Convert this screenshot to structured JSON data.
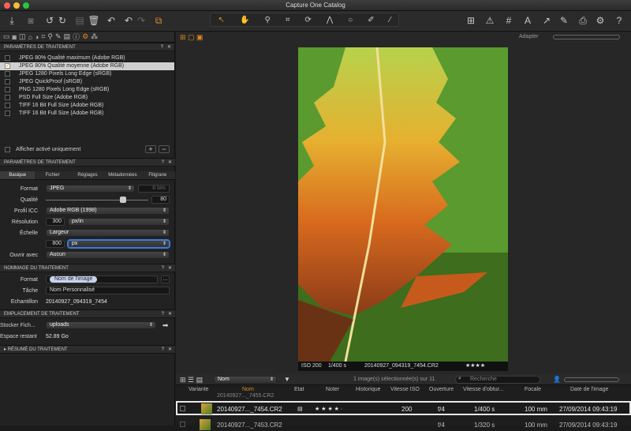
{
  "window": {
    "title": "Capture One Catalog"
  },
  "toolbar": {
    "adapter": "Adapter"
  },
  "recipes": {
    "header": "PARAMÈTRES DE TRAITEMENT",
    "items": [
      {
        "label": "JPEG 80% Qualité maximum (Adobe RGB)",
        "checked": false
      },
      {
        "label": "JPEG 80% Qualité moyenne (Adobe RGB)",
        "checked": true
      },
      {
        "label": "JPEG 1280 Pixels Long Edge (sRGB)",
        "checked": false
      },
      {
        "label": "JPEG QuickProof (sRGB)",
        "checked": false
      },
      {
        "label": "PNG 1280 Pixels Long Edge (sRGB)",
        "checked": false
      },
      {
        "label": "PSD Full Size (Adobe RGB)",
        "checked": false
      },
      {
        "label": "TIFF 16 Bit Full Size (Adobe RGB)",
        "checked": false
      },
      {
        "label": "TIFF 16 Bit Full Size (Adobe RGB)",
        "checked": false
      }
    ],
    "show_active": "Afficher activé uniquement"
  },
  "settings": {
    "header": "PARAMÈTRES DE TRAITEMENT",
    "tabs": [
      "Basique",
      "Fichier",
      "Réglages",
      "Métadonnées",
      "Filigrane"
    ],
    "format_label": "Format",
    "format_value": "JPEG",
    "bits": "8 bits",
    "quality_label": "Qualité",
    "quality_value": "80",
    "icc_label": "Profil ICC",
    "icc_value": "Adobe RGB (1998)",
    "res_label": "Résolution",
    "res_value": "300",
    "res_unit": "px/in",
    "scale_label": "Échelle",
    "scale_value": "Largeur",
    "size_value": "800",
    "size_unit": "px",
    "open_label": "Ouvrir avec",
    "open_value": "Aucun"
  },
  "naming": {
    "header": "NOMMAGE DU TRAITEMENT",
    "format_label": "Format",
    "format_token": "Nom de l'image",
    "task_label": "Tâche",
    "task_value": "Nom Personnalisé",
    "sample_label": "Echantillon",
    "sample_value": "20140927_094319_7454"
  },
  "location": {
    "header": "EMPLACEMENT DE TRAITEMENT",
    "store_label": "Stocker Fich...",
    "store_value": "uploads",
    "space_label": "Espace restant",
    "space_value": "52.89 Go"
  },
  "summary": {
    "header": "RÉSUMÉ DU TRAITEMENT"
  },
  "viewer": {
    "iso": "ISO 200",
    "shutter": "1/400 s",
    "filename": "20140927_094319_7454.CR2",
    "stars": "★★★★"
  },
  "browser": {
    "sort": "Nom",
    "count": "1 image(s) sélectionnée(s) sur 11",
    "search_placeholder": "Recherche",
    "columns": [
      "Variante",
      "Nom",
      "Etat",
      "Noter",
      "Historique",
      "Vitesse ISO",
      "Ouverture",
      "Vitesse d'obtur...",
      "Focale",
      "Date de l'image"
    ],
    "rows": [
      {
        "name": "20140927..._7454.CR2",
        "stars": "★ ★ ★ ★ ·",
        "iso": "200",
        "aperture": "f/4",
        "shutter": "1/400 s",
        "focal": "100 mm",
        "date": "27/09/2014 09:43:19"
      },
      {
        "name": "20140927..._7453.CR2",
        "stars": "",
        "iso": "",
        "aperture": "f/4",
        "shutter": "1/320 s",
        "focal": "100 mm",
        "date": "27/09/2014 09:43:19"
      }
    ],
    "partial_name": "20140927..._7455.CR2"
  }
}
